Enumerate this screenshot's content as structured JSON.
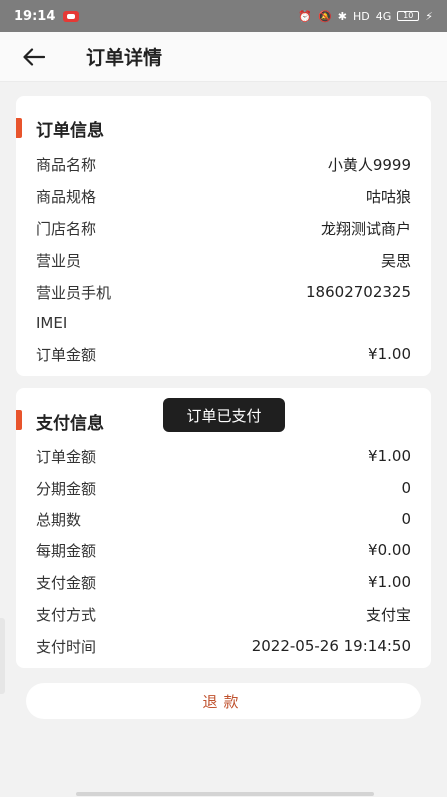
{
  "status_bar": {
    "time": "19:14",
    "icons": [
      "alarm-icon",
      "mute-icon",
      "bluetooth-icon",
      "hd-icon",
      "signal-icon",
      "battery-icon",
      "charging-icon"
    ],
    "hd_label": "HD",
    "signal_label": "4G",
    "battery_label": "10"
  },
  "header": {
    "title": "订单详情"
  },
  "order_info": {
    "title": "订单信息",
    "rows": [
      {
        "label": "商品名称",
        "value": "小黄人9999"
      },
      {
        "label": "商品规格",
        "value": "咕咕狼"
      },
      {
        "label": "门店名称",
        "value": "龙翔测试商户"
      },
      {
        "label": "营业员",
        "value": "吴思"
      },
      {
        "label": "营业员手机",
        "value": "18602702325"
      },
      {
        "label": "IMEI",
        "value": ""
      },
      {
        "label": "订单金额",
        "value": "¥1.00"
      }
    ]
  },
  "payment_info": {
    "title": "支付信息",
    "rows": [
      {
        "label": "订单金额",
        "value": "¥1.00"
      },
      {
        "label": "分期金额",
        "value": "0"
      },
      {
        "label": "总期数",
        "value": "0"
      },
      {
        "label": "每期金额",
        "value": "¥0.00"
      },
      {
        "label": "支付金额",
        "value": "¥1.00"
      },
      {
        "label": "支付方式",
        "value": "支付宝"
      },
      {
        "label": "支付时间",
        "value": "2022-05-26 19:14:50"
      }
    ]
  },
  "toast": "订单已支付",
  "refund_button": "退款",
  "colors": {
    "accent": "#e8542c",
    "refund_text": "#c0532f",
    "toast_bg": "#1f1f1f",
    "page_bg": "#f2f2f2"
  }
}
